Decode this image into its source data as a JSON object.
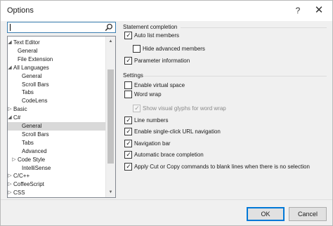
{
  "window": {
    "title": "Options",
    "help_glyph": "?",
    "close_glyph": "✕"
  },
  "search": {
    "value": "",
    "icon": "search-icon"
  },
  "tree": {
    "items": [
      {
        "label": "Text Editor",
        "arrow": "◢"
      },
      {
        "label": "General",
        "arrow": ""
      },
      {
        "label": "File Extension",
        "arrow": ""
      },
      {
        "label": "All Languages",
        "arrow": "◢"
      },
      {
        "label": "General",
        "arrow": ""
      },
      {
        "label": "Scroll Bars",
        "arrow": ""
      },
      {
        "label": "Tabs",
        "arrow": ""
      },
      {
        "label": "CodeLens",
        "arrow": ""
      },
      {
        "label": "Basic",
        "arrow": "▷"
      },
      {
        "label": "C#",
        "arrow": "◢"
      },
      {
        "label": "General",
        "arrow": "",
        "selected": true
      },
      {
        "label": "Scroll Bars",
        "arrow": ""
      },
      {
        "label": "Tabs",
        "arrow": ""
      },
      {
        "label": "Advanced",
        "arrow": ""
      },
      {
        "label": "Code Style",
        "arrow": "▷"
      },
      {
        "label": "IntelliSense",
        "arrow": ""
      },
      {
        "label": "C/C++",
        "arrow": "▷"
      },
      {
        "label": "CoffeeScript",
        "arrow": "▷"
      },
      {
        "label": "CSS",
        "arrow": "▷"
      }
    ]
  },
  "scrollbar": {
    "up_glyph": "▲",
    "down_glyph": "▼"
  },
  "statement_completion": {
    "title": "Statement completion",
    "options": [
      {
        "label": "Auto list members",
        "checked": true,
        "enabled": true
      },
      {
        "label": "Hide advanced members",
        "checked": false,
        "enabled": true
      },
      {
        "label": "Parameter information",
        "checked": true,
        "enabled": true
      }
    ]
  },
  "settings": {
    "title": "Settings",
    "options": [
      {
        "label": "Enable virtual space",
        "checked": false,
        "enabled": true
      },
      {
        "label": "Word wrap",
        "checked": false,
        "enabled": true
      },
      {
        "label": "Show visual glyphs for word wrap",
        "checked": true,
        "enabled": false
      },
      {
        "label": "Line numbers",
        "checked": true,
        "enabled": true
      },
      {
        "label": "Enable single-click URL navigation",
        "checked": true,
        "enabled": true
      },
      {
        "label": "Navigation bar",
        "checked": true,
        "enabled": true
      },
      {
        "label": "Automatic brace completion",
        "checked": true,
        "enabled": true
      },
      {
        "label": "Apply Cut or Copy commands to blank lines when there is no selection",
        "checked": true,
        "enabled": true
      }
    ]
  },
  "footer": {
    "ok_label": "OK",
    "cancel_label": "Cancel"
  },
  "check_glyph": "✓",
  "colors": {
    "accent": "#0078d7",
    "selection": "#d9d9d9"
  }
}
